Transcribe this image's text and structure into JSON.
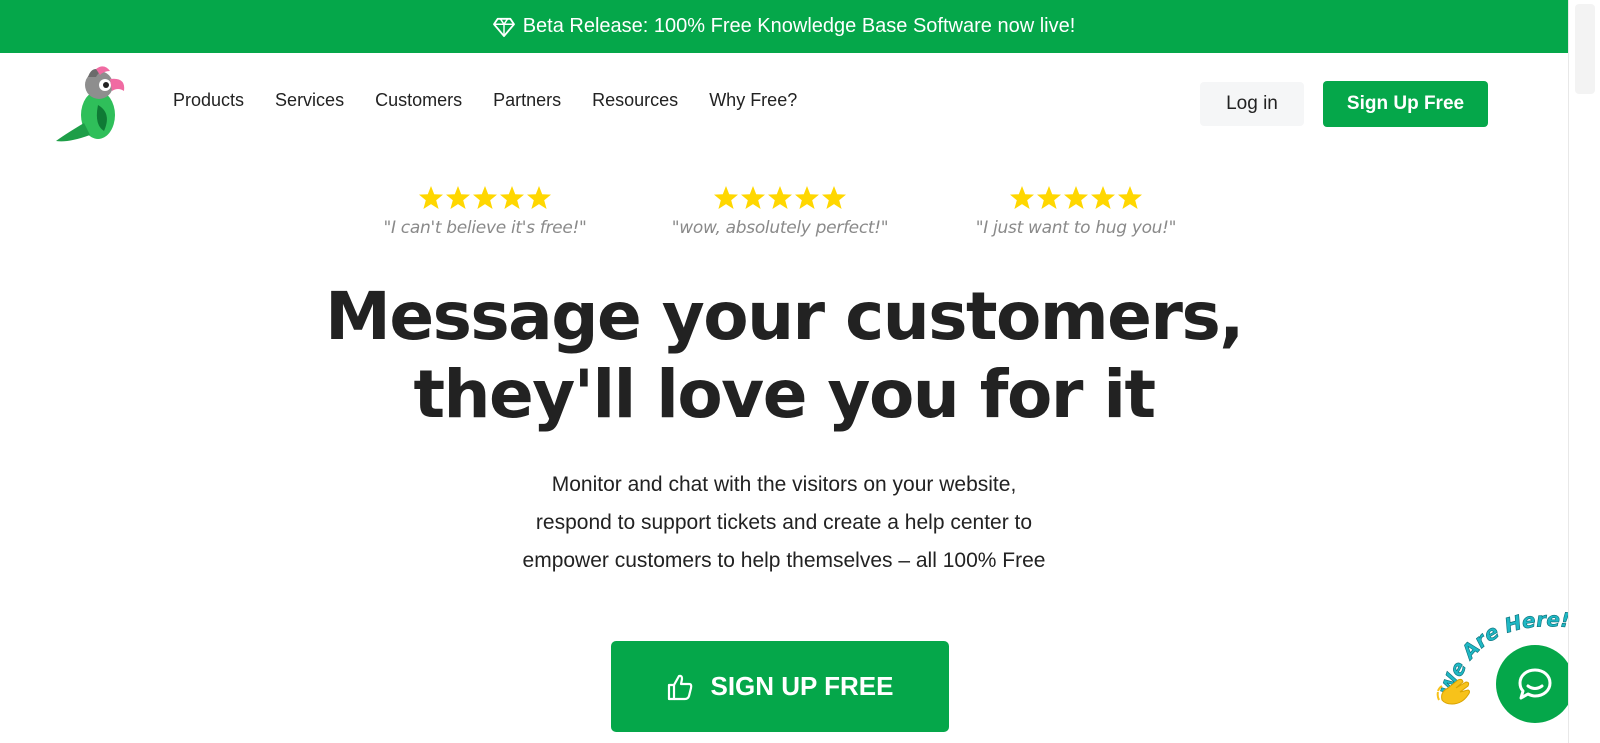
{
  "banner": {
    "icon": "diamond-icon",
    "text": "Beta Release: 100% Free Knowledge Base Software now live!"
  },
  "nav": {
    "items": [
      {
        "label": "Products"
      },
      {
        "label": "Services"
      },
      {
        "label": "Customers"
      },
      {
        "label": "Partners"
      },
      {
        "label": "Resources"
      },
      {
        "label": "Why Free?"
      }
    ],
    "login_label": "Log in",
    "signup_label": "Sign Up Free"
  },
  "reviews": [
    {
      "stars": 5,
      "quote": "\"I can't believe it's free!\""
    },
    {
      "stars": 5,
      "quote": "\"wow, absolutely perfect!\""
    },
    {
      "stars": 5,
      "quote": "\"I just want to hug you!\""
    }
  ],
  "hero": {
    "headline_line1": "Message your customers,",
    "headline_line2": "they'll love you for it",
    "sub_line1": "Monitor and chat with the visitors on your website,",
    "sub_line2": "respond to support tickets and create a help center to",
    "sub_line3": "empower customers to help themselves – all 100% Free",
    "cta_label": "SIGN UP FREE",
    "cta_icon": "thumbs-up-icon"
  },
  "chat_widget": {
    "tagline": "We Are Here!",
    "icon": "chat-bubble-icon"
  },
  "colors": {
    "brand_green": "#05a74a",
    "star_yellow": "#ffd700",
    "text_dark": "#222222",
    "quote_gray": "#8a8a8a"
  }
}
